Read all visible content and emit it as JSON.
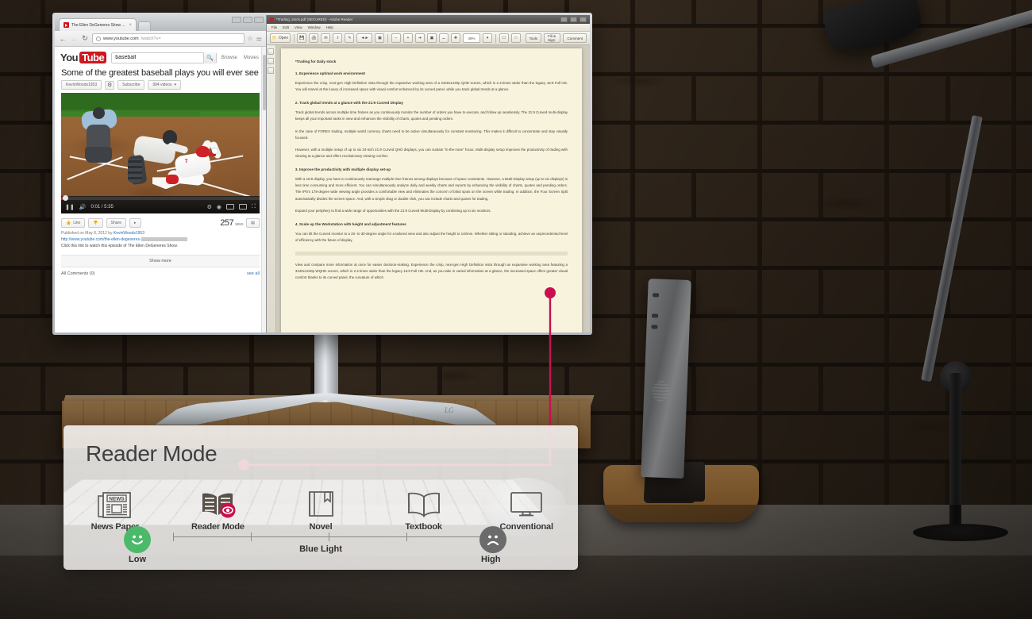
{
  "panel": {
    "title": "Reader Mode",
    "modes": [
      {
        "label": "News Paper",
        "icon": "newspaper-icon"
      },
      {
        "label": "Reader Mode",
        "icon": "open-book-eye-icon"
      },
      {
        "label": "Novel",
        "icon": "closed-book-bookmark-icon"
      },
      {
        "label": "Textbook",
        "icon": "open-book-outline-icon"
      },
      {
        "label": "Conventional",
        "icon": "monitor-icon"
      }
    ],
    "scale": {
      "title": "Blue Light",
      "low_label": "Low",
      "high_label": "High",
      "low_face": "smiley-happy-icon",
      "high_face": "smiley-sad-icon",
      "low_color": "#4cb96a",
      "high_color": "#6b6b6b"
    },
    "accent_color": "#c8104f"
  },
  "browser": {
    "tab": {
      "title": "The Ellen DeGeneres Show ...",
      "close": "×",
      "favicon": "youtube-favicon"
    },
    "new_tab": "+",
    "window_buttons": [
      "minimize",
      "maximize",
      "close"
    ],
    "nav": {
      "back": "←",
      "forward": "→",
      "reload": "↻"
    },
    "url_base": "www.youtube.com",
    "url_path": "/watch?v=",
    "omni_right": [
      "star-icon",
      "wrench-icon"
    ]
  },
  "youtube": {
    "logo_you": "You",
    "logo_tube": "Tube",
    "search_value": "baseball",
    "search_placeholder": "Search",
    "search_icon": "search-icon",
    "nav": [
      "Browse",
      "Movies"
    ],
    "video_title": "Some of the greatest baseball plays you will ever see",
    "channel": "KevinWoods1953",
    "subscribe": "Subscribe",
    "gear_icon": "gear-icon",
    "quality": "994 videos",
    "player": {
      "pause_icon": "pause-icon",
      "volume_icon": "volume-icon",
      "time": "0:01 / 5:35",
      "settings_icon": "gear-icon",
      "captions_icon": "captions-icon",
      "theater_icon": "theater-mode-icon",
      "pip_icon": "pip-icon",
      "fullscreen_icon": "fullscreen-icon"
    },
    "actions": {
      "like": "Like",
      "like_icon": "thumb-up-icon",
      "dislike_icon": "thumb-down-icon",
      "share": "Share",
      "more_icon": "more-arrow-icon"
    },
    "views_count": "257",
    "views_label": "views",
    "stats_icon": "stats-bar-icon",
    "published": "Published on May 8, 2012 by",
    "published_by": "KevinWoods1953",
    "desc_link": "http://www.youtube.com/the-ellen-degeneres-",
    "desc_text": "Click this link to watch this episode of The Ellen DeGeneres Show.",
    "show_more": "Show more",
    "comments_label": "All Comments (0)",
    "see_all": "see all"
  },
  "reader": {
    "window_title": "*Trading_stock.pdf (SECURED) - Adobe Reader",
    "menus": [
      "File",
      "Edit",
      "View",
      "Window",
      "Help"
    ],
    "open_label": "Open",
    "zoom_value": "49%",
    "right_buttons": [
      "Tools",
      "Fill & Sign",
      "Comment"
    ],
    "doc": {
      "heading": "*Trading for Daily stock",
      "s1_title": "1. Experience optimal work environment",
      "s1_p1": "Experience the crisp, next-gen High Definition vista through the expansive working area of a 3440x1440p QHD screen, which is 2.4-times wider than the legacy 16:9 Full HD. You will marvel at the luxury of increased space with visual comfort enhanced by its curved panel, while you track global trends at a glance.",
      "s2_title": "2. Track global trends at a glance with the 21:9 Curved Display",
      "s2_p1": "Track global trends across multiple time frames as you continuously monitor the number of orders you have to execute, and follow up seamlessly. The 21:9 Curved multi-display keeps all your important tasks in view and enhances the visibility of charts, quotes and pending orders.",
      "s2_p2": "In the case of FOREX trading, multiple world currency charts need to be active simultaneously for constant monitoring. This makes it difficult to concentrate and stay visually focused.",
      "s2_p3": "However, with a multiple setup of up to six 34-inch 21:9 Curved QHD displays, you can sustain \"in-the-zone\" focus. Multi-display setup improves the productivity of trading with viewing at a glance and offers revolutionary viewing comfort.",
      "s3_title": "3. Improve the productivity with multiple display set-up",
      "s3_p1": "With a 16:9 display, you have to continuously rearrange multiple time frames among displays because of space constraints. However, a Multi-Display setup (up to six displays) is less time consuming and more efficient. You can simultaneously analyze daily and weekly charts and reports by enhancing the visibility of charts, quotes and pending orders. The IPS's 178-degree wide viewing angle provides a comfortable view and eliminates the concern of blind spots on the screen while trading. In addition, the Four Screen Split automatically divides the screen space. And, with a simple drag or double click, you can include charts and quotes for trading.",
      "s3_p2": "Expand your periphery to find a wide range of opportunities with the 21:9 Curved Multi-Display by combining up to six monitors.",
      "s4_title": "4. Scale up the Workstation with height and adjustment features",
      "s4_p1": "You can tilt the Curved monitor to a 20- to 30-degree angle for a tailored view and also adjust the height to 140mm. Whether sitting or standing, achieve an unprecedented level of efficiency with the future of display.",
      "s5_p1": "View and compare more information at once for easier decision-making. Experience the crisp, next-gen High Definition vista through an expansive working area featuring a 3440x1440p WQHD screen, which is 2.4-times wider than the legacy 16:9 Full HD. And, as you take in varied information at a glance, the increased space offers greater visual comfort thanks to its curved panel, the curvature of which"
    }
  },
  "monitor": {
    "brand": "LG"
  }
}
